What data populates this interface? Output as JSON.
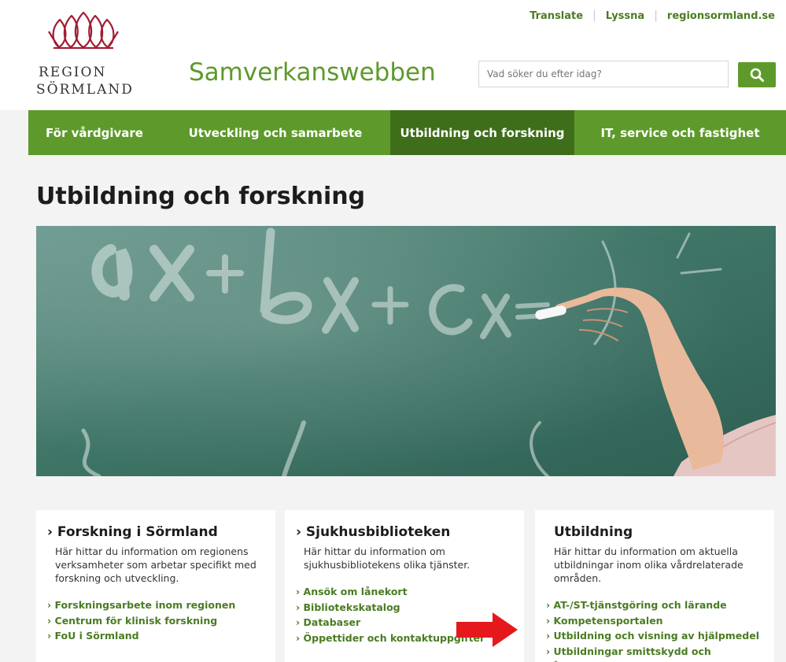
{
  "colors": {
    "brand_green": "#5d9a2b",
    "nav_active": "#3f6e1b",
    "logo_red": "#a21c31",
    "arrow_red": "#e5181c"
  },
  "header": {
    "top_links": [
      "Translate",
      "Lyssna",
      "regionsormland.se"
    ],
    "logo": {
      "line1": "REGION",
      "line2": "SÖRMLAND",
      "icon": "flower-logo-icon"
    },
    "site_name": "Samverkanswebben",
    "search": {
      "placeholder": "Vad söker du efter idag?",
      "icon": "search-icon"
    }
  },
  "nav": {
    "items": [
      {
        "label": "För vårdgivare"
      },
      {
        "label": "Utveckling och samarbete"
      },
      {
        "label": "Utbildning och forskning",
        "active": true
      },
      {
        "label": "IT, service och fastighet"
      }
    ]
  },
  "main": {
    "title": "Utbildning och forskning",
    "cards": [
      {
        "title": "› Forskning i Sörmland",
        "text": "Här hittar du information om regionens verksamheter som arbetar specifikt med forskning och utveckling.",
        "links": [
          "Forskningsarbete inom regionen",
          "Centrum för klinisk forskning",
          "FoU i Sörmland"
        ]
      },
      {
        "title": "› Sjukhusbiblioteken",
        "text": "Här hittar du information om sjukhusbibliotekens olika tjänster.",
        "links": [
          "Ansök om lånekort",
          "Bibliotekskatalog",
          "Databaser",
          "Öppettider och kontaktuppgifter"
        ]
      },
      {
        "title": "Utbildning",
        "text": "Här hittar du information om aktuella utbildningar inom olika vårdrelaterade områden.",
        "links": [
          "AT-/ST-tjänstgöring och lärande",
          "Kompetensportalen",
          "Utbildning och visning av hjälpmedel",
          "Utbildningar smittskydd och vårdhygien"
        ]
      }
    ]
  }
}
